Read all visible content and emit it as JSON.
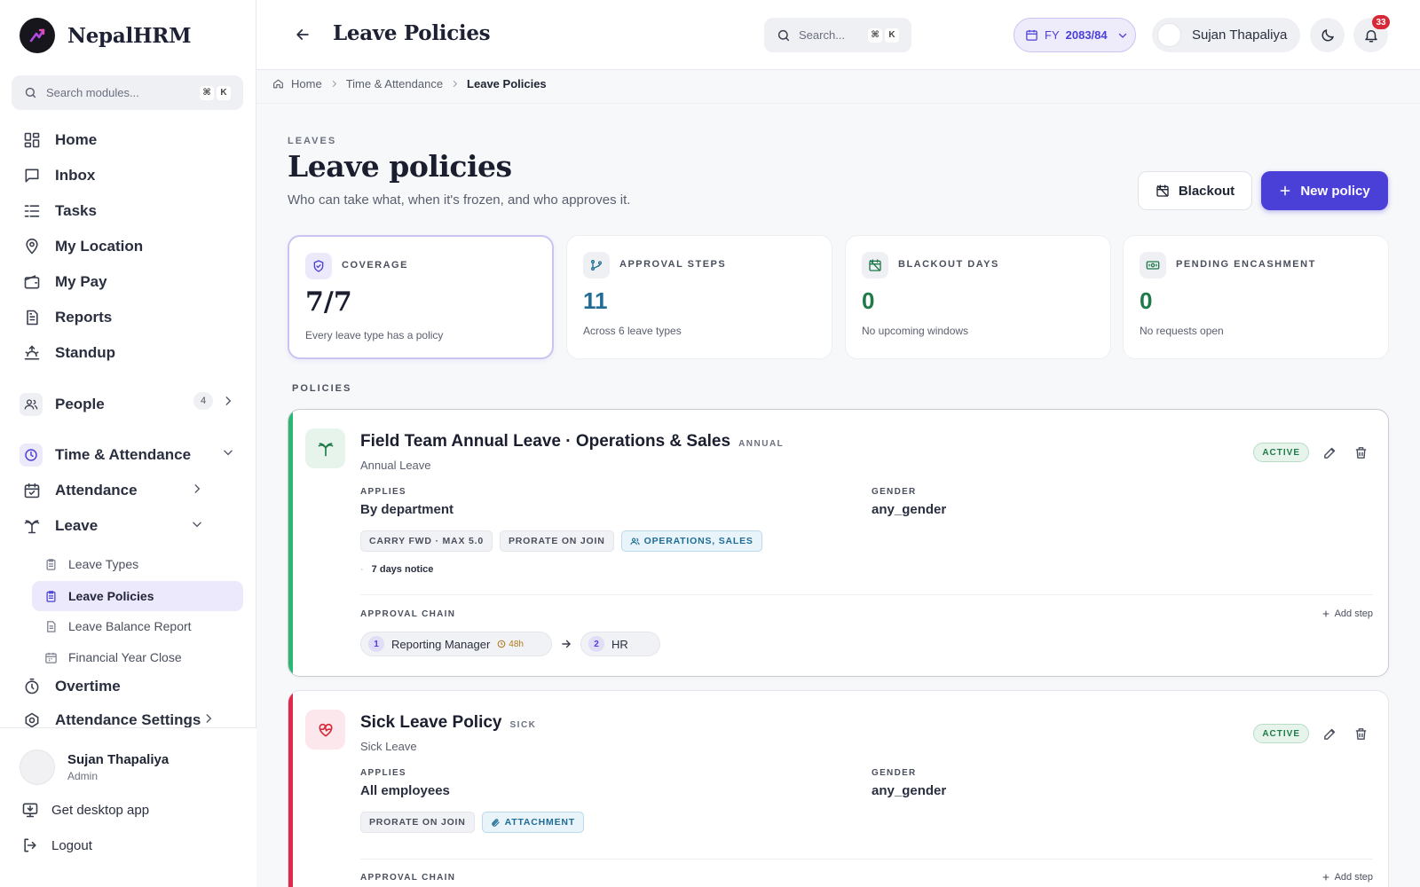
{
  "brand": {
    "name": "NepalHRM"
  },
  "sidebar": {
    "search_placeholder": "Search modules...",
    "kbd": [
      "⌘",
      "K"
    ],
    "items": [
      {
        "label": "Home",
        "icon": "dashboard-icon"
      },
      {
        "label": "Inbox",
        "icon": "message-icon"
      },
      {
        "label": "Tasks",
        "icon": "list-icon"
      },
      {
        "label": "My Location",
        "icon": "location-pin-icon"
      },
      {
        "label": "My Pay",
        "icon": "wallet-icon"
      },
      {
        "label": "Reports",
        "icon": "document-icon"
      },
      {
        "label": "Standup",
        "icon": "sunrise-icon"
      }
    ],
    "people": {
      "label": "People",
      "count": "4"
    },
    "time_attendance": {
      "label": "Time & Attendance"
    },
    "attendance": {
      "label": "Attendance"
    },
    "leave": {
      "label": "Leave"
    },
    "leave_sub": [
      {
        "label": "Leave Types"
      },
      {
        "label": "Leave Policies"
      },
      {
        "label": "Leave Balance Report"
      },
      {
        "label": "Financial Year Close"
      }
    ],
    "overtime": {
      "label": "Overtime"
    },
    "attendance_settings": {
      "label": "Attendance Settings"
    },
    "user": {
      "name": "Sujan Thapaliya",
      "role": "Admin"
    },
    "desktop_app": "Get desktop app",
    "logout": "Logout"
  },
  "topbar": {
    "title": "Leave Policies",
    "search_placeholder": "Search...",
    "kbd": [
      "⌘",
      "K"
    ],
    "fy_prefix": "FY",
    "fy_value": "2083/84",
    "user_name": "Sujan Thapaliya",
    "notifications": "33"
  },
  "breadcrumb": [
    "Home",
    "Time & Attendance",
    "Leave Policies"
  ],
  "page": {
    "eyebrow": "LEAVES",
    "title": "Leave policies",
    "subtitle": "Who can take what, when it's frozen, and who approves it.",
    "blackout_button": "Blackout",
    "new_policy_button": "New policy"
  },
  "stats": [
    {
      "label": "COVERAGE",
      "value": "7/7",
      "note": "Every leave type has a policy",
      "color": "#1a1e2e"
    },
    {
      "label": "APPROVAL STEPS",
      "value": "11",
      "note": "Across 6 leave types",
      "color": "#1f6d96"
    },
    {
      "label": "BLACKOUT DAYS",
      "value": "0",
      "note": "No upcoming windows",
      "color": "#1f7a4a"
    },
    {
      "label": "PENDING ENCASHMENT",
      "value": "0",
      "note": "No requests open",
      "color": "#1f7a4a"
    }
  ],
  "policies_label": "POLICIES",
  "policies": [
    {
      "title": "Field Team Annual Leave · Operations & Sales",
      "kind": "ANNUAL",
      "type": "Annual Leave",
      "status": "ACTIVE",
      "applies_label": "APPLIES",
      "applies": "By department",
      "gender_label": "GENDER",
      "gender": "any_gender",
      "chips": [
        "CARRY FWD · MAX 5.0",
        "PRORATE ON JOIN",
        "OPERATIONS, SALES"
      ],
      "notice_bullet": "·",
      "notice": "7 days notice",
      "chain_label": "APPROVAL CHAIN",
      "add_step": "Add step",
      "steps": [
        {
          "num": "1",
          "name": "Reporting Manager",
          "sla": "48h"
        },
        {
          "num": "2",
          "name": "HR"
        }
      ],
      "accent": "#2bb673"
    },
    {
      "title": "Sick Leave Policy",
      "kind": "SICK",
      "type": "Sick Leave",
      "status": "ACTIVE",
      "applies_label": "APPLIES",
      "applies": "All employees",
      "gender_label": "GENDER",
      "gender": "any_gender",
      "chips": [
        "PRORATE ON JOIN",
        "ATTACHMENT"
      ],
      "chain_label": "APPROVAL CHAIN",
      "add_step": "Add step",
      "accent": "#e0284a"
    }
  ]
}
